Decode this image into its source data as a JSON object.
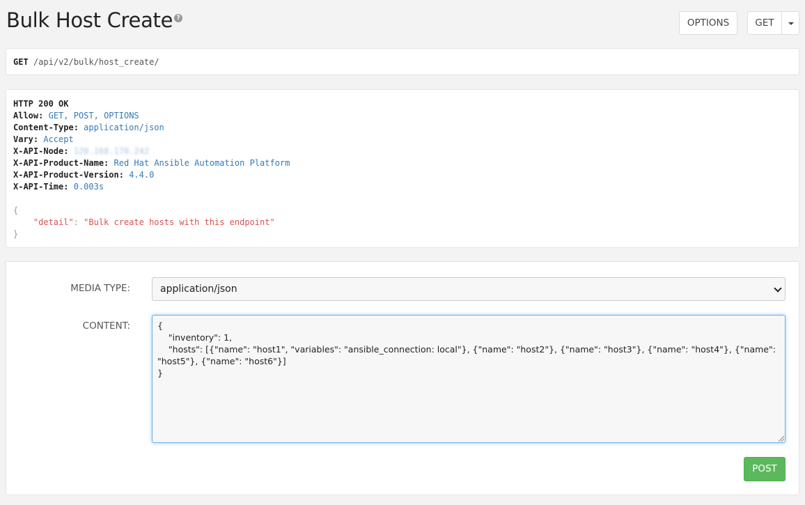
{
  "page": {
    "title": "Bulk Host Create"
  },
  "toolbar": {
    "options_label": "OPTIONS",
    "get_label": "GET"
  },
  "url": {
    "method": "GET",
    "sep": "/",
    "parts": [
      "api",
      "v2",
      "bulk",
      "host_create"
    ]
  },
  "response": {
    "status": "HTTP 200 OK",
    "headers": [
      {
        "key": "Allow:",
        "value": "GET, POST, OPTIONS"
      },
      {
        "key": "Content-Type:",
        "value": "application/json"
      },
      {
        "key": "Vary:",
        "value": "Accept"
      },
      {
        "key": "X-API-Node:",
        "value": "120.168.170.242"
      },
      {
        "key": "X-API-Product-Name:",
        "value": "Red Hat Ansible Automation Platform"
      },
      {
        "key": "X-API-Product-Version:",
        "value": "4.4.0"
      },
      {
        "key": "X-API-Time:",
        "value": "0.003s"
      }
    ],
    "body_open": "{",
    "body_key": "\"detail\"",
    "body_colon": ": ",
    "body_value": "\"Bulk create hosts with this endpoint\"",
    "body_close": "}"
  },
  "form": {
    "media_type_label": "MEDIA TYPE:",
    "media_type_value": "application/json",
    "content_label": "CONTENT:",
    "content_value": "{\n    \"inventory\": 1,\n    \"hosts\": [{\"name\": \"host1\", \"variables\": \"ansible_connection: local\"}, {\"name\": \"host2\"}, {\"name\": \"host3\"}, {\"name\": \"host4\"}, {\"name\": \"host5\"}, {\"name\": \"host6\"}]\n}",
    "post_label": "POST"
  }
}
